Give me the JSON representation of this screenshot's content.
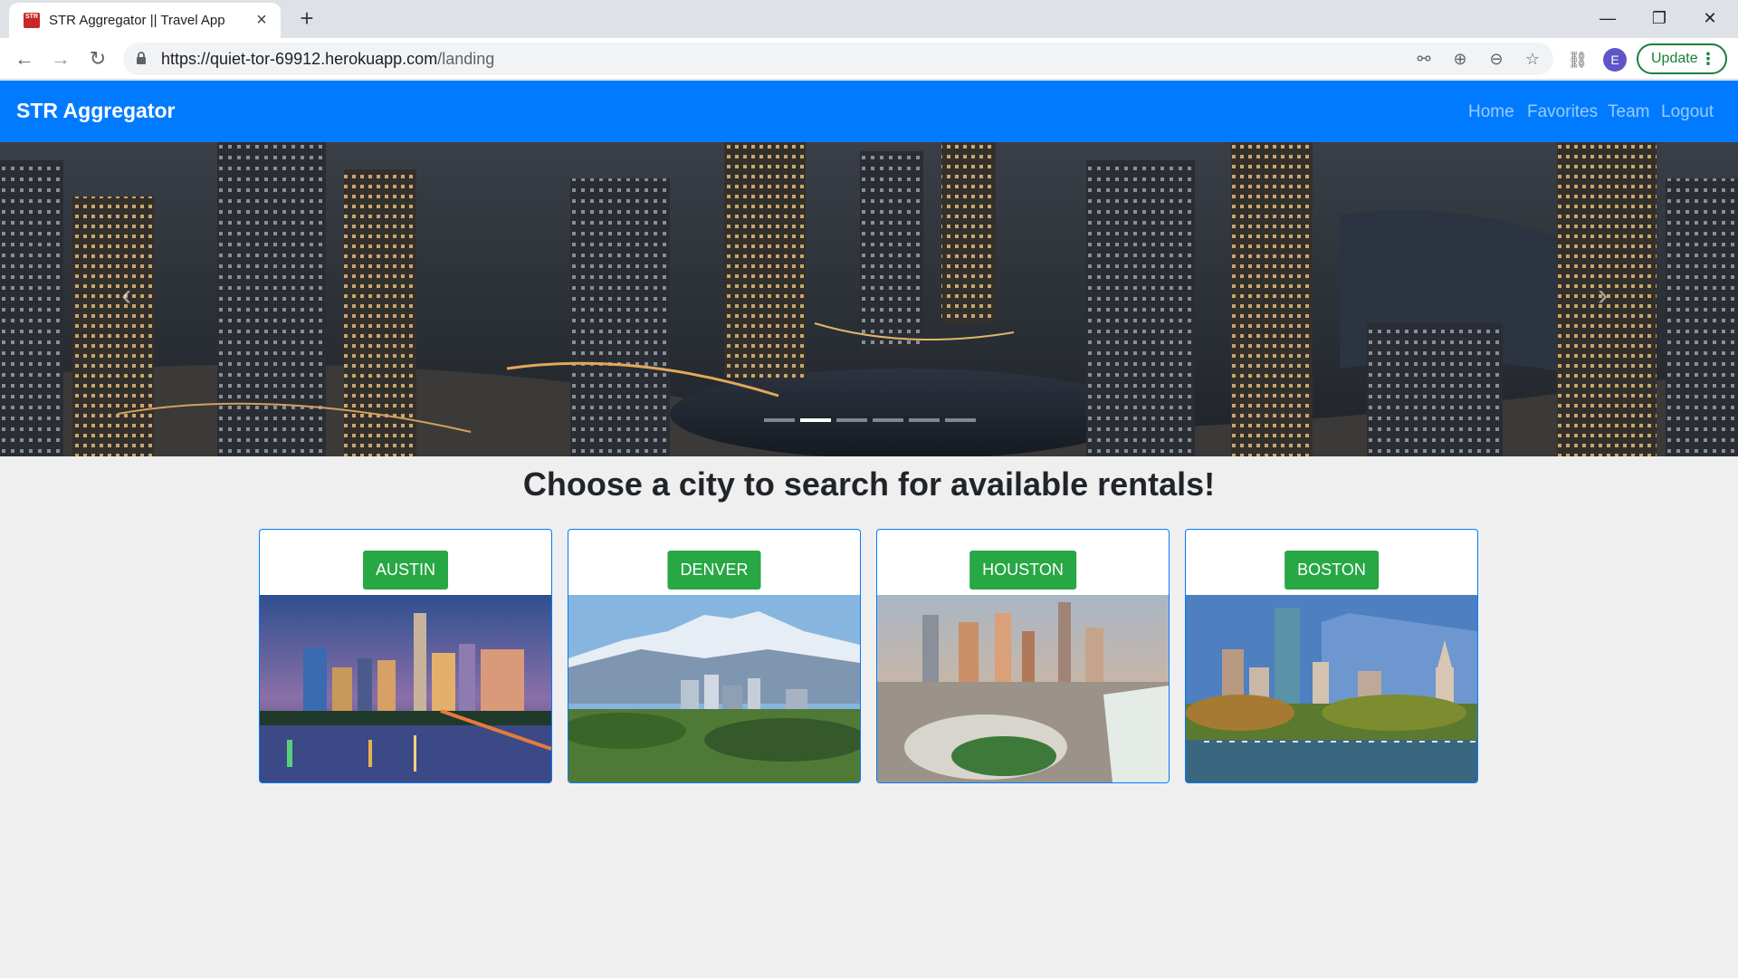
{
  "browser": {
    "tab_title": "STR Aggregator || Travel App",
    "favicon_text": "STR",
    "url_host": "https://quiet-tor-69912.herokuapp.com",
    "url_path": "/landing",
    "profile_initial": "E",
    "update_label": "Update"
  },
  "icons": {
    "back": "arrow-left-icon",
    "forward": "arrow-right-icon",
    "reload": "reload-icon",
    "lock": "lock-icon",
    "key": "key-icon",
    "zoom": "zoom-icon",
    "star": "star-icon",
    "extensions": "puzzle-icon",
    "carousel_prev": "chevron-left-icon",
    "carousel_next": "chevron-right-icon"
  },
  "navbar": {
    "brand": "STR Aggregator",
    "links": [
      "Home",
      "Favorites",
      "Team",
      "Logout"
    ]
  },
  "carousel": {
    "slide_count": 6,
    "active_index": 1
  },
  "main": {
    "heading": "Choose a city to search for available rentals!",
    "cities": [
      "AUSTIN",
      "DENVER",
      "HOUSTON",
      "BOSTON"
    ]
  },
  "colors": {
    "navbar": "#007bff",
    "city_button": "#28a745",
    "update_green": "#188038"
  }
}
